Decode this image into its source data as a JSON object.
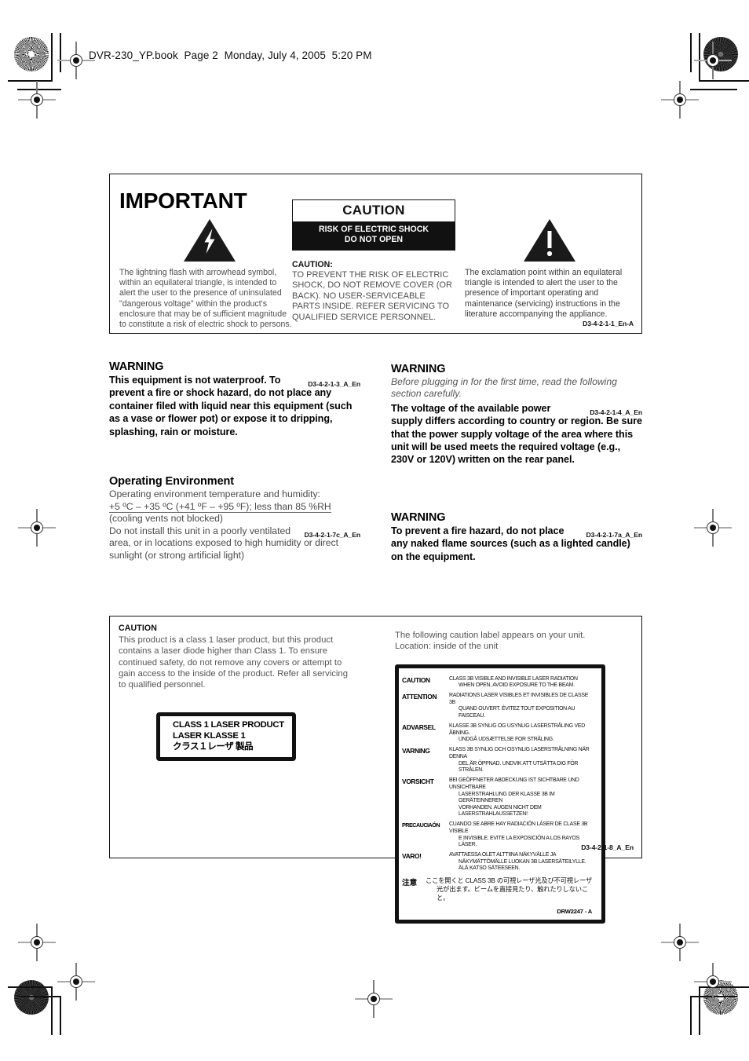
{
  "page": {
    "file_header": "DVR-230_YP.book  Page 2  Monday, July 4, 2005  5:20 PM"
  },
  "important_box": {
    "title": "IMPORTANT",
    "lightning_caption": "The lightning flash with arrowhead symbol, within an equilateral triangle, is intended to alert the user to the presence of uninsulated \"dangerous voltage\" within the product's enclosure that may be of sufficient magnitude to constitute a risk of electric shock to persons.",
    "badge": {
      "title": "CAUTION",
      "line1": "RISK OF ELECTRIC SHOCK",
      "line2": "DO NOT OPEN"
    },
    "caution_lead": "CAUTION:",
    "caution_text": "TO PREVENT THE RISK OF ELECTRIC SHOCK, DO NOT REMOVE COVER (OR BACK).  NO USER-SERVICEABLE PARTS INSIDE.  REFER SERVICING TO QUALIFIED SERVICE PERSONNEL.",
    "exclamation_caption": "The exclamation point within an equilateral triangle is intended to alert the user to the presence of important operating and maintenance (servicing) instructions in the literature accompanying the appliance.",
    "code": "D3-4-2-1-1_En-A"
  },
  "warnings": {
    "waterproof": {
      "heading": "WARNING",
      "body": "This equipment is not waterproof. To prevent a fire or shock hazard, do not place any container filed with liquid near this equipment (such as a vase or flower pot) or expose it to dripping, splashing, rain or moisture.",
      "code": "D3-4-2-1-3_A_En"
    },
    "operating_environment": {
      "heading": "Operating Environment",
      "line1": "Operating environment temperature and humidity:",
      "line2": "+5 ºC – +35 ºC (+41 ºF – +95 ºF); less than 85 %RH",
      "line3": "(cooling vents not blocked)",
      "line4": "Do not install this unit in a poorly ventilated area, or in locations exposed to high humidity or direct sunlight (or strong artificial light)",
      "code": "D3-4-2-1-7c_A_En"
    },
    "voltage": {
      "heading": "WARNING",
      "italic": "Before plugging in for the first time, read the following section carefully.",
      "body": "The voltage of the available power supply differs according to country or region. Be sure that the power supply voltage of the area where this unit will be used meets the required voltage (e.g., 230V or 120V) written on the rear panel.",
      "code": "D3-4-2-1-4_A_En"
    },
    "flame": {
      "heading": "WARNING",
      "body": "To prevent a fire hazard, do not place any naked flame sources (such as a lighted candle) on the equipment.",
      "code": "D3-4-2-1-7a_A_En"
    }
  },
  "laser_box": {
    "heading": "CAUTION",
    "body": "This product is a class 1 laser product, but this product contains a laser diode higher than Class 1. To ensure continued safety, do not remove any covers or attempt to gain access to the inside of the product. Refer all servicing to qualified personnel.",
    "class1_label": {
      "line1": "CLASS 1 LASER PRODUCT",
      "line2": "LASER KLASSE 1",
      "line3": "クラス１レーザ 製品"
    },
    "label_intro_line1": "The following caution label appears on your unit.",
    "label_intro_line2": "Location: inside of the unit",
    "drw_label": {
      "rows": [
        {
          "lang": "CAUTION",
          "lines": [
            "CLASS 3B VISIBLE AND INVISIBLE LASER RADIATION",
            "WHEN OPEN, AVOID  EXPOSURE  TO  THE  BEAM."
          ]
        },
        {
          "lang": "ATTENTION",
          "lines": [
            "RADIATIONS LASER VISIBLES ET INVISIBLES DE CLASSE 3B",
            "QUAND OUVERT. ÉVITEZ TOUT EXPOSITION AU FAISCEAU."
          ]
        },
        {
          "lang": "ADVARSEL",
          "lines": [
            "KLASSE 3B SYNLIG OG USYNLIG LASERSTRÅLING VED ÅBNING.",
            "UNDGÅ UDSÆTTELSE FOR STRÅLING."
          ]
        },
        {
          "lang": "VARNING",
          "lines": [
            "KLASS  3B  SYNLIG OCH OSYNLIG LASERSTRÅLNING NÄR DENNA",
            "DEL ÄR ÖPPNAD.  UNDVIK  ATT  UTSÄTTA DIG FÖR  STRÅLEN."
          ]
        },
        {
          "lang": "VORSICHT",
          "lines": [
            "BEI GEÖFFNETER ABDECKUNG IST SICHTBARE UND UNSICHTBARE",
            "LASERSTRAHLUNG DER KLASSE 3B  IM GERÄTEINNEREN",
            "VORHANDEN. AUGEN NICHT DEM LASERSTRAHLAUSSETZEN!"
          ]
        },
        {
          "lang": "PRECAUCIAÓN",
          "lines": [
            "CUANDO SE ABRE HAY RADIACIÓN LÁSER DE CLASE 3B VISIBLE",
            "E INVISIBLE.  EVITE  LA  EXPOSICIÓN  A LOS RAYOS LÁSER."
          ]
        },
        {
          "lang": "VARO!",
          "lines": [
            "AVATTAESSA  OLET  ALTTIINA  NÄKYVÄLLE  JA",
            "NÄKYMÄTTÖMÄLLE LUOKAN  3B  LASERSÄTEILYLLE.",
            "ÄLÄ  KATSO  SÄTEESEEN."
          ]
        }
      ],
      "jp_row": {
        "lang": "注意",
        "lines": [
          "ここを開くと CLASS 3B の可視レーザ光及び不可視レーザ",
          "光が出ます。ビームを直接見たり、触れたりしないこと。"
        ]
      },
      "code": "DRW2247 - A"
    },
    "code": "D3-4-2-1-8_A_En"
  }
}
